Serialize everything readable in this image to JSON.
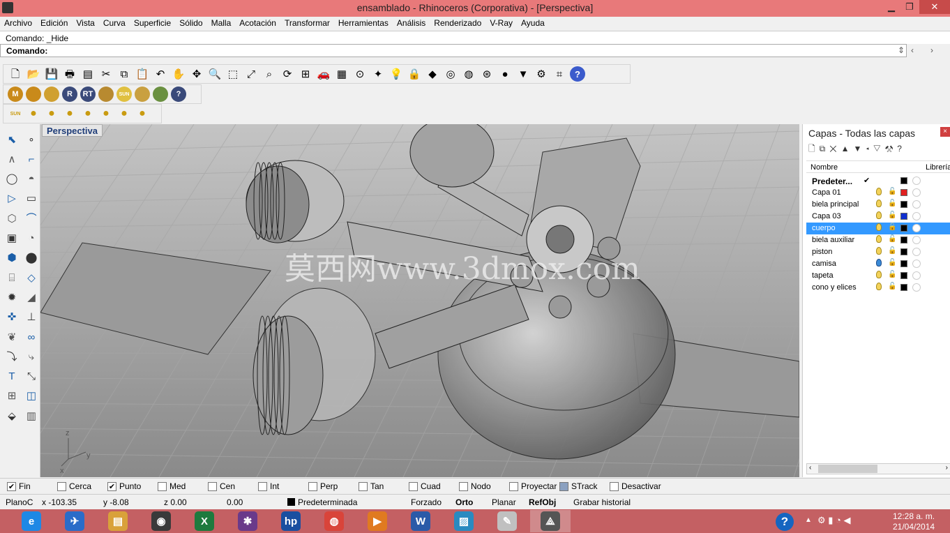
{
  "window": {
    "title": "ensamblado - Rhinoceros (Corporativa) - [Perspectiva]",
    "minimize": "▁",
    "maximize": "❐",
    "close": "✕"
  },
  "menu": [
    "Archivo",
    "Edición",
    "Vista",
    "Curva",
    "Superficie",
    "Sólido",
    "Malla",
    "Acotación",
    "Transformar",
    "Herramientas",
    "Análisis",
    "Renderizado",
    "V-Ray",
    "Ayuda"
  ],
  "command": {
    "history": "Comando: _Hide",
    "label": "Comando:",
    "value": ""
  },
  "toolbar_icons": [
    "new-file-icon",
    "open-folder-icon",
    "save-icon",
    "print-icon",
    "properties-icon",
    "cut-icon",
    "copy-icon",
    "paste-icon",
    "undo-icon",
    "pan-hand-icon",
    "rotate-view-icon",
    "zoom-icon",
    "zoom-window-icon",
    "zoom-extents-icon",
    "zoom-selected-icon",
    "rotate-icon",
    "four-viewports-icon",
    "car-icon",
    "grid-icon",
    "osnap-icon",
    "point-icon",
    "light-bulb-icon",
    "lock-icon",
    "render-color-icon",
    "color-wheel-icon",
    "sphere-wire-icon",
    "mesh-sphere-icon",
    "sphere-shaded-icon",
    "filter-icon",
    "options-icon",
    "dimension-icon",
    "help-icon"
  ],
  "toolbar2": [
    "M",
    "",
    "",
    "R",
    "RT",
    "",
    "SUN",
    "",
    "",
    "?"
  ],
  "toolbar3": [
    "SUN",
    "",
    "",
    "",
    "",
    "",
    "",
    ""
  ],
  "viewport": {
    "tab": "Perspectiva",
    "watermark": "莫西网www.3dmox.com",
    "axes": {
      "x": "x",
      "y": "y",
      "z": "z"
    }
  },
  "layers": {
    "title": "Capas - Todas las capas",
    "header": {
      "name": "Nombre",
      "library": "Librería"
    },
    "rows": [
      {
        "name": "Predeter...",
        "color": "#000000",
        "current": "✔",
        "bold": true
      },
      {
        "name": "Capa 01",
        "color": "#e02020"
      },
      {
        "name": "biela principal",
        "color": "#000000"
      },
      {
        "name": "Capa 03",
        "color": "#1030d0"
      },
      {
        "name": "cuerpo",
        "color": "#000000",
        "selected": true
      },
      {
        "name": "biela auxiliar",
        "color": "#000000"
      },
      {
        "name": "piston",
        "color": "#000000"
      },
      {
        "name": "camisa",
        "color": "#000000",
        "bulb_color": "#3a8ad6"
      },
      {
        "name": "tapeta",
        "color": "#000000"
      },
      {
        "name": "cono y elices",
        "color": "#000000"
      }
    ]
  },
  "osnaps": [
    {
      "label": "Fin",
      "checked": true
    },
    {
      "label": "Cerca",
      "checked": false
    },
    {
      "label": "Punto",
      "checked": true
    },
    {
      "label": "Med",
      "checked": false
    },
    {
      "label": "Cen",
      "checked": false
    },
    {
      "label": "Int",
      "checked": false
    },
    {
      "label": "Perp",
      "checked": false
    },
    {
      "label": "Tan",
      "checked": false
    },
    {
      "label": "Cuad",
      "checked": false
    },
    {
      "label": "Nodo",
      "checked": false
    },
    {
      "label": "Proyectar",
      "checked": false
    },
    {
      "label": "STrack",
      "checked": false
    },
    {
      "label": "Desactivar",
      "checked": false
    }
  ],
  "status": {
    "plane": "PlanoC",
    "x": "x -103.35",
    "y": "y -8.08",
    "z": "z 0.00",
    "d": "0.00",
    "layer": "Predeterminada",
    "forzado": "Forzado",
    "orto": "Orto",
    "planar": "Planar",
    "refobj": "RefObj",
    "history": "Grabar historial"
  },
  "taskbar": {
    "time": "12:28 a. m.",
    "date": "21/04/2014",
    "apps": [
      "ie",
      "rocket",
      "explorer",
      "eye",
      "excel",
      "puzzle",
      "hp",
      "chrome",
      "media",
      "word",
      "photos",
      "paint",
      "rhino"
    ]
  }
}
